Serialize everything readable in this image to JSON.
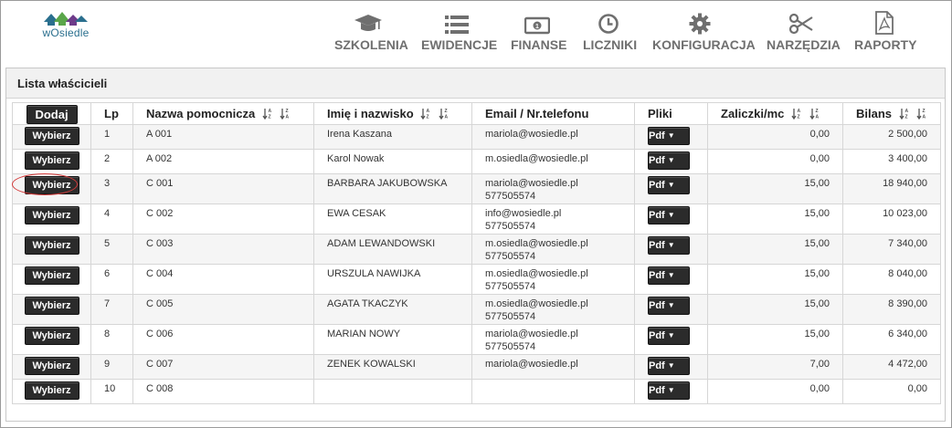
{
  "app": {
    "logo_text": "wOsiedle",
    "logo_name": "wosiedle-logo"
  },
  "nav": [
    {
      "label": "SZKOLENIA",
      "icon": "graduation-cap-icon"
    },
    {
      "label": "EWIDENCJE",
      "icon": "list-icon"
    },
    {
      "label": "FINANSE",
      "icon": "money-icon"
    },
    {
      "label": "LICZNIKI",
      "icon": "clock-icon"
    },
    {
      "label": "KONFIGURACJA",
      "icon": "gear-icon"
    },
    {
      "label": "NARZĘDZIA",
      "icon": "scissors-icon"
    },
    {
      "label": "RAPORTY",
      "icon": "pdf-document-icon"
    }
  ],
  "panel": {
    "title": "Lista właścicieli"
  },
  "table": {
    "add_button": "Dodaj",
    "headers": {
      "lp": "Lp",
      "nazwa": "Nazwa pomocnicza",
      "imie": "Imię i nazwisko",
      "email": "Email / Nr.telefonu",
      "pliki": "Pliki",
      "zaliczki": "Zaliczki/mc",
      "bilans": "Bilans"
    },
    "select_label": "Wybierz",
    "pdf_label": "Pdf",
    "rows": [
      {
        "lp": "1",
        "nazwa": "A 001",
        "imie": "Irena Kaszana",
        "email": "mariola@wosiedle.pl",
        "phone": "",
        "zaliczki": "0,00",
        "bilans": "2 500,00"
      },
      {
        "lp": "2",
        "nazwa": "A 002",
        "imie": "Karol Nowak",
        "email": "m.osiedla@wosiedle.pl",
        "phone": "",
        "zaliczki": "0,00",
        "bilans": "3 400,00"
      },
      {
        "lp": "3",
        "nazwa": "C 001",
        "imie": "BARBARA JAKUBOWSKA",
        "email": "mariola@wosiedle.pl",
        "phone": "577505574",
        "zaliczki": "15,00",
        "bilans": "18 940,00"
      },
      {
        "lp": "4",
        "nazwa": "C 002",
        "imie": "EWA CESAK",
        "email": "info@wosiedle.pl",
        "phone": "577505574",
        "zaliczki": "15,00",
        "bilans": "10 023,00"
      },
      {
        "lp": "5",
        "nazwa": "C 003",
        "imie": "ADAM LEWANDOWSKI",
        "email": "m.osiedla@wosiedle.pl",
        "phone": "577505574",
        "zaliczki": "15,00",
        "bilans": "7 340,00"
      },
      {
        "lp": "6",
        "nazwa": "C 004",
        "imie": "URSZULA NAWIJKA",
        "email": "m.osiedla@wosiedle.pl",
        "phone": "577505574",
        "zaliczki": "15,00",
        "bilans": "8 040,00"
      },
      {
        "lp": "7",
        "nazwa": "C 005",
        "imie": "AGATA TKACZYK",
        "email": "m.osiedla@wosiedle.pl",
        "phone": "577505574",
        "zaliczki": "15,00",
        "bilans": "8 390,00"
      },
      {
        "lp": "8",
        "nazwa": "C 006",
        "imie": "MARIAN NOWY",
        "email": "mariola@wosiedle.pl",
        "phone": "577505574",
        "zaliczki": "15,00",
        "bilans": "6 340,00"
      },
      {
        "lp": "9",
        "nazwa": "C 007",
        "imie": "ZENEK KOWALSKI",
        "email": "mariola@wosiedle.pl",
        "phone": "",
        "zaliczki": "7,00",
        "bilans": "4 472,00"
      },
      {
        "lp": "10",
        "nazwa": "C 008",
        "imie": "",
        "email": "",
        "phone": "",
        "zaliczki": "0,00",
        "bilans": "0,00"
      }
    ]
  },
  "colors": {
    "accent_blue": "#2a6f8e",
    "nav_gray": "#6f6f6f",
    "button_dark": "#2b2b2b",
    "highlight_red": "#d43a3a"
  }
}
